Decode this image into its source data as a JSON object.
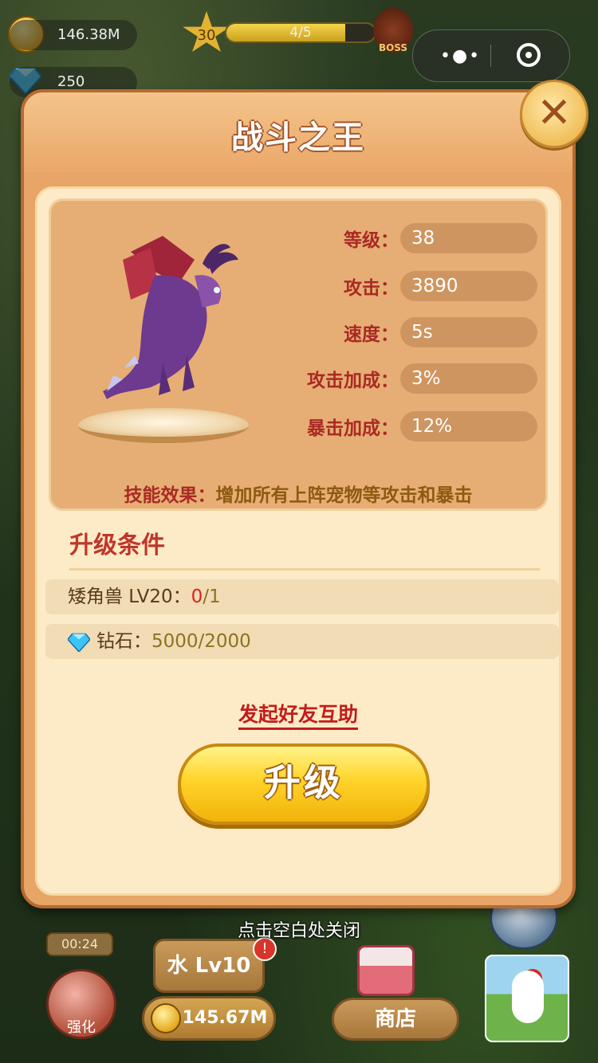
{
  "hud": {
    "gold": "146.38M",
    "gems": "250",
    "level_star": "30",
    "stage_progress": "4/5",
    "stage_fraction": 0.8,
    "boss_label": "BOSS"
  },
  "dialog": {
    "title": "战斗之王",
    "close_icon": "close-x-icon",
    "stats": [
      {
        "label": "等级：",
        "value": "38"
      },
      {
        "label": "攻击：",
        "value": "3890"
      },
      {
        "label": "速度：",
        "value": "5s"
      },
      {
        "label": "攻击加成：",
        "value": "3%"
      },
      {
        "label": "暴击加成：",
        "value": "12%"
      }
    ],
    "skill_label": "技能效果：",
    "skill_text": "增加所有上阵宠物等攻击和暴击",
    "requirements_title": "升级条件",
    "requirements": [
      {
        "name": "矮角兽 LV20：",
        "have": "0",
        "need": "/1"
      },
      {
        "name": "钻石：",
        "value": "5000/2000",
        "icon": "diamond-icon"
      }
    ],
    "help_link": "发起好友互助",
    "upgrade_button": "升级"
  },
  "close_hint": "点击空白处关闭",
  "bottom": {
    "timer": "00:24",
    "strength_label": "强化",
    "water_button": "水 Lv10",
    "notice_badge": "!",
    "coins": "145.67M",
    "shop_button": "商店"
  }
}
